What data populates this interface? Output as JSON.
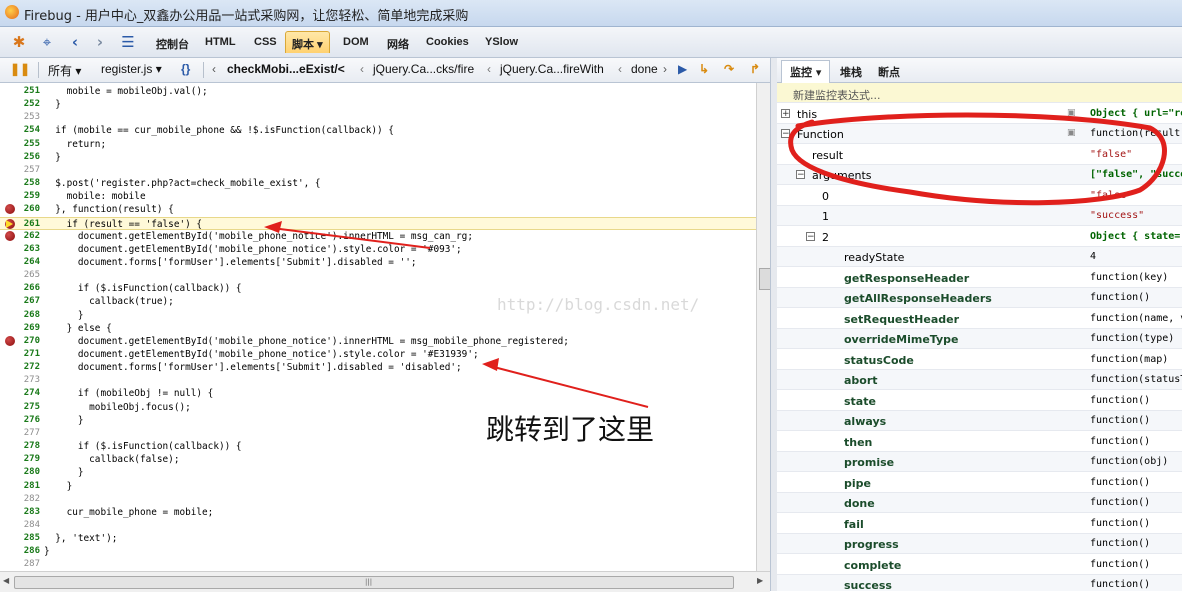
{
  "window": {
    "title": "Firebug - 用户中心_双鑫办公用品一站式采购网，让您轻松、简单地完成采购"
  },
  "toolbar": {
    "tabs": [
      "控制台",
      "HTML",
      "CSS",
      "脚本",
      "DOM",
      "网络",
      "Cookies",
      "YSlow"
    ],
    "active_tab": "脚本"
  },
  "script_toolbar": {
    "filter": "所有",
    "file": "register.js",
    "braces": "{}",
    "stack": [
      "checkMobi...eExist/<",
      "jQuery.Ca...cks/fire",
      "jQuery.Ca...fireWith",
      "done"
    ]
  },
  "code_lines": [
    {
      "n": "251",
      "t": "    mobile = mobileObj.val();"
    },
    {
      "n": "252",
      "t": "  }"
    },
    {
      "n": "253",
      "t": ""
    },
    {
      "n": "254",
      "t": "  if (mobile == cur_mobile_phone && !$.isFunction(callback)) {"
    },
    {
      "n": "255",
      "t": "    return;"
    },
    {
      "n": "256",
      "t": "  }"
    },
    {
      "n": "257",
      "t": ""
    },
    {
      "n": "258",
      "t": "  $.post('register.php?act=check_mobile_exist', {"
    },
    {
      "n": "259",
      "t": "    mobile: mobile"
    },
    {
      "n": "260",
      "t": "  }, function(result) {"
    },
    {
      "n": "261",
      "t": "    if (result == 'false') {"
    },
    {
      "n": "262",
      "t": "      document.getElementById('mobile_phone_notice').innerHTML = msg_can_rg;"
    },
    {
      "n": "263",
      "t": "      document.getElementById('mobile_phone_notice').style.color = '#093';"
    },
    {
      "n": "264",
      "t": "      document.forms['formUser'].elements['Submit'].disabled = '';"
    },
    {
      "n": "265",
      "t": ""
    },
    {
      "n": "266",
      "t": "      if ($.isFunction(callback)) {"
    },
    {
      "n": "267",
      "t": "        callback(true);"
    },
    {
      "n": "268",
      "t": "      }"
    },
    {
      "n": "269",
      "t": "    } else {"
    },
    {
      "n": "270",
      "t": "      document.getElementById('mobile_phone_notice').innerHTML = msg_mobile_phone_registered;"
    },
    {
      "n": "271",
      "t": "      document.getElementById('mobile_phone_notice').style.color = '#E31939';"
    },
    {
      "n": "272",
      "t": "      document.forms['formUser'].elements['Submit'].disabled = 'disabled';"
    },
    {
      "n": "273",
      "t": ""
    },
    {
      "n": "274",
      "t": "      if (mobileObj != null) {"
    },
    {
      "n": "275",
      "t": "        mobileObj.focus();"
    },
    {
      "n": "276",
      "t": "      }"
    },
    {
      "n": "277",
      "t": ""
    },
    {
      "n": "278",
      "t": "      if ($.isFunction(callback)) {"
    },
    {
      "n": "279",
      "t": "        callback(false);"
    },
    {
      "n": "280",
      "t": "      }"
    },
    {
      "n": "281",
      "t": "    }"
    },
    {
      "n": "282",
      "t": ""
    },
    {
      "n": "283",
      "t": "    cur_mobile_phone = mobile;"
    },
    {
      "n": "284",
      "t": ""
    },
    {
      "n": "285",
      "t": "  }, 'text');"
    },
    {
      "n": "286",
      "t": "}"
    },
    {
      "n": "287",
      "t": ""
    }
  ],
  "breakpoint_lines": [
    "260",
    "261",
    "262",
    "270"
  ],
  "current_line": "261",
  "executable_lines": [
    "251",
    "252",
    "254",
    "255",
    "256",
    "258",
    "259",
    "260",
    "261",
    "262",
    "263",
    "264",
    "266",
    "267",
    "268",
    "269",
    "270",
    "271",
    "272",
    "274",
    "275",
    "276",
    "278",
    "279",
    "280",
    "281",
    "283",
    "285",
    "286"
  ],
  "watch_tabs": [
    "监控",
    "堆栈",
    "断点"
  ],
  "watch": {
    "new_expression": "新建监控表达式...",
    "rows": [
      {
        "key": "this",
        "value": "Object { url=\"re",
        "kind": "obj",
        "indent": 0,
        "tw": "+",
        "lock": true
      },
      {
        "key": "Function",
        "value": "function(result)",
        "kind": "fn",
        "indent": 0,
        "tw": "−",
        "lock": true
      },
      {
        "key": "result",
        "value": "\"false\"",
        "kind": "str",
        "indent": 1
      },
      {
        "key": "arguments",
        "value": "[\"false\", \"succe",
        "kind": "obj",
        "indent": 1,
        "tw": "−"
      },
      {
        "key": "0",
        "value": "\"false\"",
        "kind": "str",
        "indent": 2
      },
      {
        "key": "1",
        "value": "\"success\"",
        "kind": "str",
        "indent": 2
      },
      {
        "key": "2",
        "value": "Object { state=",
        "kind": "obj",
        "indent": 2,
        "tw": "−"
      },
      {
        "key": "readyState",
        "value": "4",
        "kind": "fn",
        "indent": 3
      },
      {
        "key": "getResponseHeader",
        "value": "function(key)",
        "kind": "fn",
        "indent": 3,
        "bold": true
      },
      {
        "key": "getAllResponseHeaders",
        "value": "function()",
        "kind": "fn",
        "indent": 3,
        "bold": true
      },
      {
        "key": "setRequestHeader",
        "value": "function(name, va",
        "kind": "fn",
        "indent": 3,
        "bold": true
      },
      {
        "key": "overrideMimeType",
        "value": "function(type)",
        "kind": "fn",
        "indent": 3,
        "bold": true
      },
      {
        "key": "statusCode",
        "value": "function(map)",
        "kind": "fn",
        "indent": 3,
        "bold": true
      },
      {
        "key": "abort",
        "value": "function(statusTe",
        "kind": "fn",
        "indent": 3,
        "bold": true
      },
      {
        "key": "state",
        "value": "function()",
        "kind": "fn",
        "indent": 3,
        "bold": true
      },
      {
        "key": "always",
        "value": "function()",
        "kind": "fn",
        "indent": 3,
        "bold": true
      },
      {
        "key": "then",
        "value": "function()",
        "kind": "fn",
        "indent": 3,
        "bold": true
      },
      {
        "key": "promise",
        "value": "function(obj)",
        "kind": "fn",
        "indent": 3,
        "bold": true
      },
      {
        "key": "pipe",
        "value": "function()",
        "kind": "fn",
        "indent": 3,
        "bold": true
      },
      {
        "key": "done",
        "value": "function()",
        "kind": "fn",
        "indent": 3,
        "bold": true
      },
      {
        "key": "fail",
        "value": "function()",
        "kind": "fn",
        "indent": 3,
        "bold": true
      },
      {
        "key": "progress",
        "value": "function()",
        "kind": "fn",
        "indent": 3,
        "bold": true
      },
      {
        "key": "complete",
        "value": "function()",
        "kind": "fn",
        "indent": 3,
        "bold": true
      },
      {
        "key": "success",
        "value": "function()",
        "kind": "fn",
        "indent": 3,
        "bold": true
      }
    ]
  },
  "annotation": {
    "text": "跳转到了这里",
    "watermark": "http://blog.csdn.net/",
    "color": "#e0201c"
  }
}
